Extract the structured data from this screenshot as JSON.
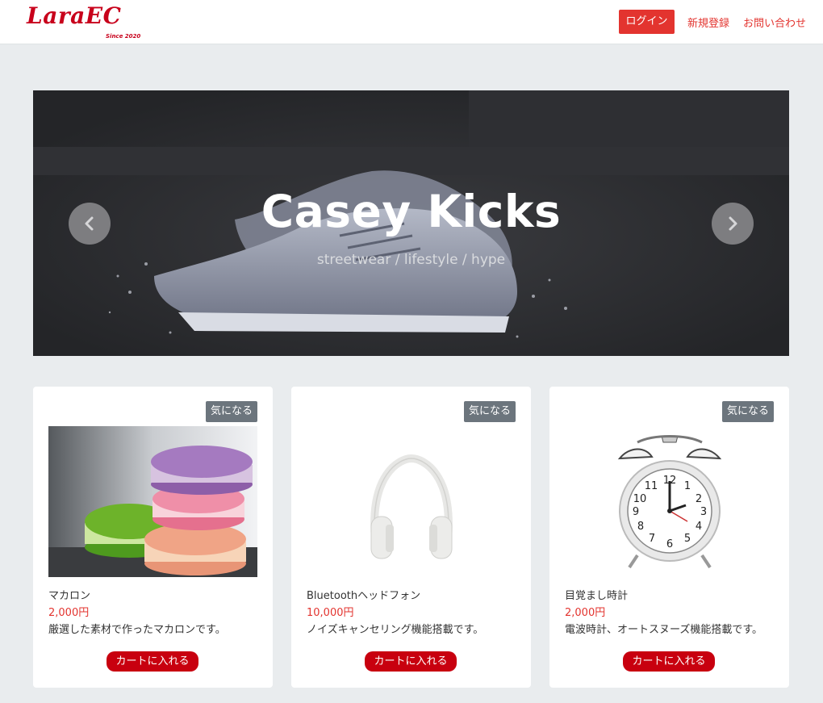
{
  "header": {
    "logo_text": "LaraEC",
    "logo_tagline": "Since 2020",
    "login_label": "ログイン",
    "register_label": "新規登録",
    "contact_label": "お問い合わせ"
  },
  "carousel": {
    "title": "Casey Kicks",
    "subtitle": "streetwear / lifestyle / hype",
    "prev_icon": "chevron-left-icon",
    "next_icon": "chevron-right-icon"
  },
  "products": [
    {
      "favorite_label": "気になる",
      "name": "マカロン",
      "price": "2,000円",
      "description": "厳選した素材で作ったマカロンです。",
      "cart_label": "カートに入れる",
      "image": "macarons"
    },
    {
      "favorite_label": "気になる",
      "name": "Bluetoothヘッドフォン",
      "price": "10,000円",
      "description": "ノイズキャンセリング機能搭載です。",
      "cart_label": "カートに入れる",
      "image": "headphones"
    },
    {
      "favorite_label": "気になる",
      "name": "目覚まし時計",
      "price": "2,000円",
      "description": "電波時計、オートスヌーズ機能搭載です。",
      "cart_label": "カートに入れる",
      "image": "alarm-clock"
    }
  ],
  "colors": {
    "brand": "#c8001b",
    "accent": "#e3342f",
    "badge": "#6c757d",
    "cart_button": "#c8000f",
    "page_bg": "#e9ecee"
  }
}
